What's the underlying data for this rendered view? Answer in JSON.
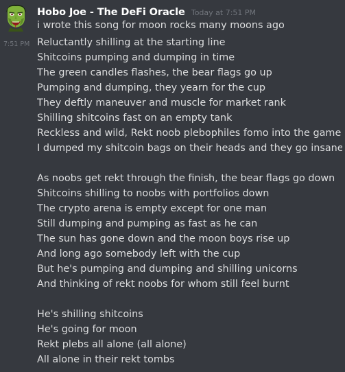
{
  "message": {
    "username": "Hobo Joe - The DeFi Oracle",
    "timestamp": "Today at 7:51 PM",
    "first_line": "i wrote this song for moon rocks many moons ago"
  },
  "followup": {
    "timestamp": "7:51 PM",
    "stanza1": [
      "Reluctantly shilling at the starting line",
      "Shitcoins pumping and dumping in time",
      "The green candles flashes, the bear flags go up",
      "Pumping and dumping, they yearn for the cup",
      "They deftly maneuver and muscle for market rank",
      "Shilling shitcoins fast on an empty tank",
      "Reckless and wild, Rekt noob plebophiles fomo into the game",
      "I dumped my shitcoin bags on their heads and they go insane"
    ],
    "stanza2": [
      "As noobs get rekt through the finish, the bear flags go down",
      "Shitcoins shilling to noobs with portfolios down",
      "The crypto arena is empty except for one man",
      "Still dumping and pumping as fast as he can",
      "The sun has gone down and the moon boys rise up",
      "And long ago somebody left with the cup",
      "But he's pumping and dumping and shilling unicorns",
      "And thinking of rekt noobs for whom still feel burnt"
    ],
    "stanza3": [
      "He's shilling shitcoins",
      "He's going for moon",
      "Rekt plebs all alone (all alone)",
      "All alone in their rekt tombs"
    ]
  },
  "icons": {
    "avatar": "green-zombie-avatar"
  },
  "colors": {
    "background": "#36393f",
    "username": "#ffffff",
    "message_text": "#dcddde",
    "timestamp": "#72767d"
  }
}
